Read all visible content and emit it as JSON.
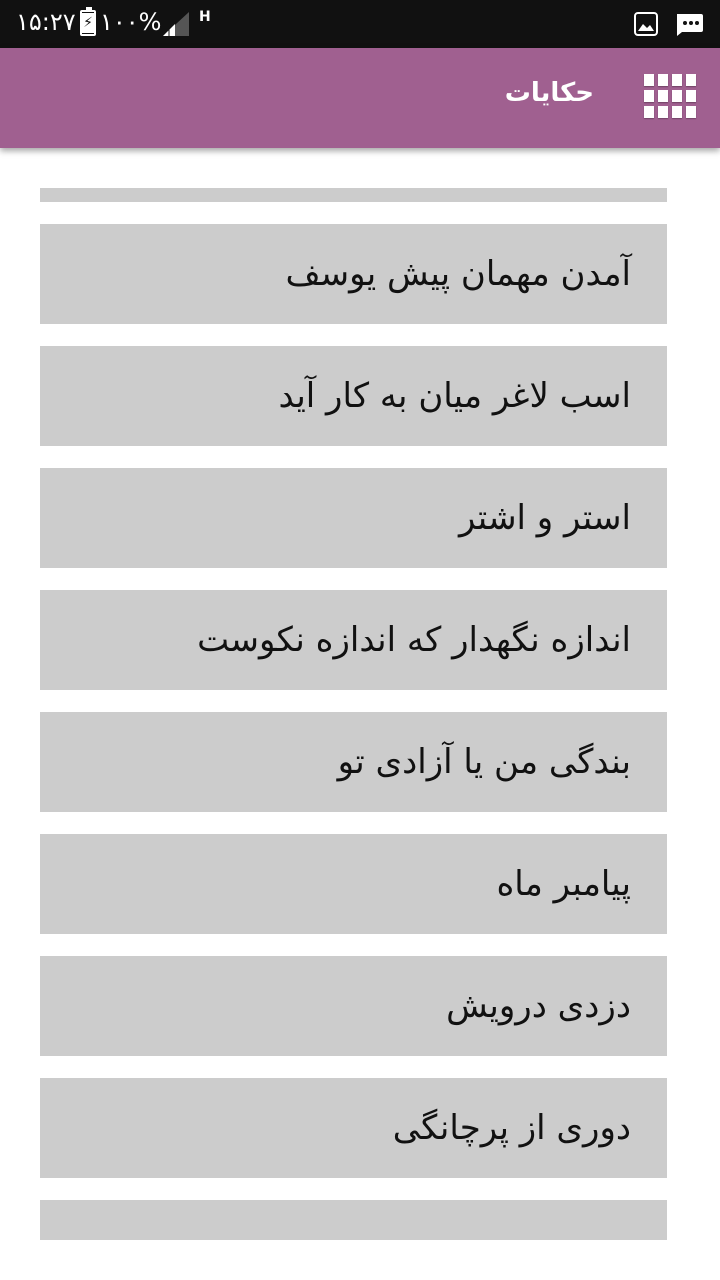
{
  "status_bar": {
    "time": "۱۵:۲۷",
    "battery": "۱۰۰%",
    "network": "H"
  },
  "app_bar": {
    "title": "حکایات",
    "menu_icon": "grid-icon"
  },
  "list": {
    "items": [
      {
        "label": "آمدن مهمان پیش یوسف"
      },
      {
        "label": "اسب لاغر میان به کار آید"
      },
      {
        "label": "استر و اشتر"
      },
      {
        "label": "اندازه نگهدار که اندازه نکوست"
      },
      {
        "label": "بندگی من یا آزادی تو"
      },
      {
        "label": "پیامبر ماه"
      },
      {
        "label": "دزدی درویش"
      },
      {
        "label": "دوری از پرچانگی"
      },
      {
        "label": "..."
      }
    ]
  }
}
